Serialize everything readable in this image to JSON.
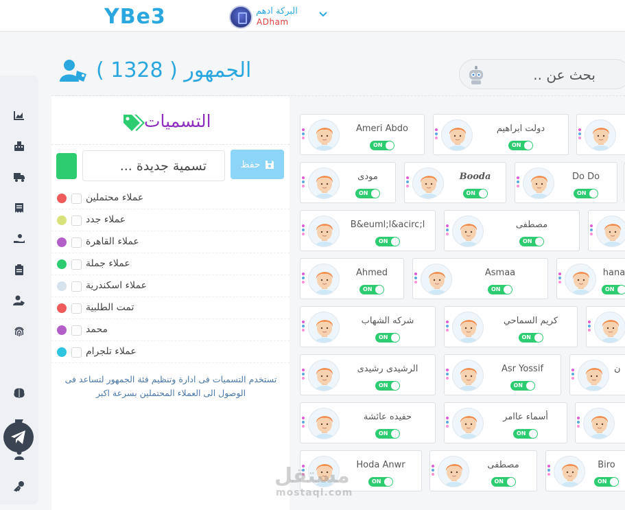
{
  "app": {
    "logo": "YBe3"
  },
  "user": {
    "name_ar": "البركة ادهم",
    "name_en": "ADham"
  },
  "sidebar": {
    "items": [
      "chart-icon",
      "keyboard-icon",
      "truck-icon",
      "receipt-icon",
      "hand-coin-icon",
      "clipboard-icon",
      "user-tag-icon",
      "fingerprint-icon",
      "telegram-icon",
      "brain-icon",
      "flag-icon",
      "user-icon",
      "key-icon"
    ],
    "active": "telegram-icon"
  },
  "header": {
    "title": "الجمهور ( 1328 )",
    "search_placeholder": "بحث عن .."
  },
  "tags": {
    "title": "التسميات",
    "new_tag_placeholder": "تسمية جديدة ...",
    "new_tag_color": "#2ecc71",
    "save_label": "حفظ",
    "items": [
      {
        "label": "عملاء محتملين",
        "color": "#ef5b5b"
      },
      {
        "label": "عملاء جدد",
        "color": "#d9e27a"
      },
      {
        "label": "عملاء القاهرة",
        "color": "#b45fc8"
      },
      {
        "label": "عملاء جملة",
        "color": "#2ecc71"
      },
      {
        "label": "عملاء اسكندرية",
        "color": "#d6e2ee"
      },
      {
        "label": "تمت الطلبية",
        "color": "#ef5b5b"
      },
      {
        "label": "محمد",
        "color": "#b45fc8"
      },
      {
        "label": "عملاء تلجرام",
        "color": "#2ec4e0"
      }
    ],
    "help": "تستخدم التسميات فى ادارة وتنظيم فئة الجمهور لتساعد فى الوصول الى العملاء المحتملين بسرعة اكبر"
  },
  "audience": {
    "toggle_label": "ON",
    "dot_colors": [
      "#e05bd6",
      "#5ba8e0",
      "#ff8fd8"
    ],
    "rows": [
      [
        {
          "name": "Ameri Abdo"
        },
        {
          "name": "دولت ابراهيم"
        },
        {
          "name": ""
        }
      ],
      [
        {
          "name": "مودى"
        },
        {
          "name": "Booda"
        },
        {
          "name": "Do Do"
        },
        {
          "name": ""
        }
      ],
      [
        {
          "name": "B&euml;l&acirc;l"
        },
        {
          "name": "مصطفى"
        },
        {
          "name": ""
        }
      ],
      [
        {
          "name": "Ahmed"
        },
        {
          "name": "Asmaa"
        },
        {
          "name": "hana"
        }
      ],
      [
        {
          "name": "شركه الشهاب"
        },
        {
          "name": "كريم السماحي"
        },
        {
          "name": ""
        }
      ],
      [
        {
          "name": "الرشيدى رشيدى"
        },
        {
          "name": "Asr Yossif"
        },
        {
          "name": "ن"
        }
      ],
      [
        {
          "name": "حفيده عائشة"
        },
        {
          "name": "أسماء عاامر"
        },
        {
          "name": ""
        }
      ],
      [
        {
          "name": "Hoda Anwr"
        },
        {
          "name": "مصطفى"
        },
        {
          "name": "Biro"
        }
      ]
    ]
  },
  "watermark": {
    "ar": "مستقل",
    "en": "mostaql.com"
  }
}
